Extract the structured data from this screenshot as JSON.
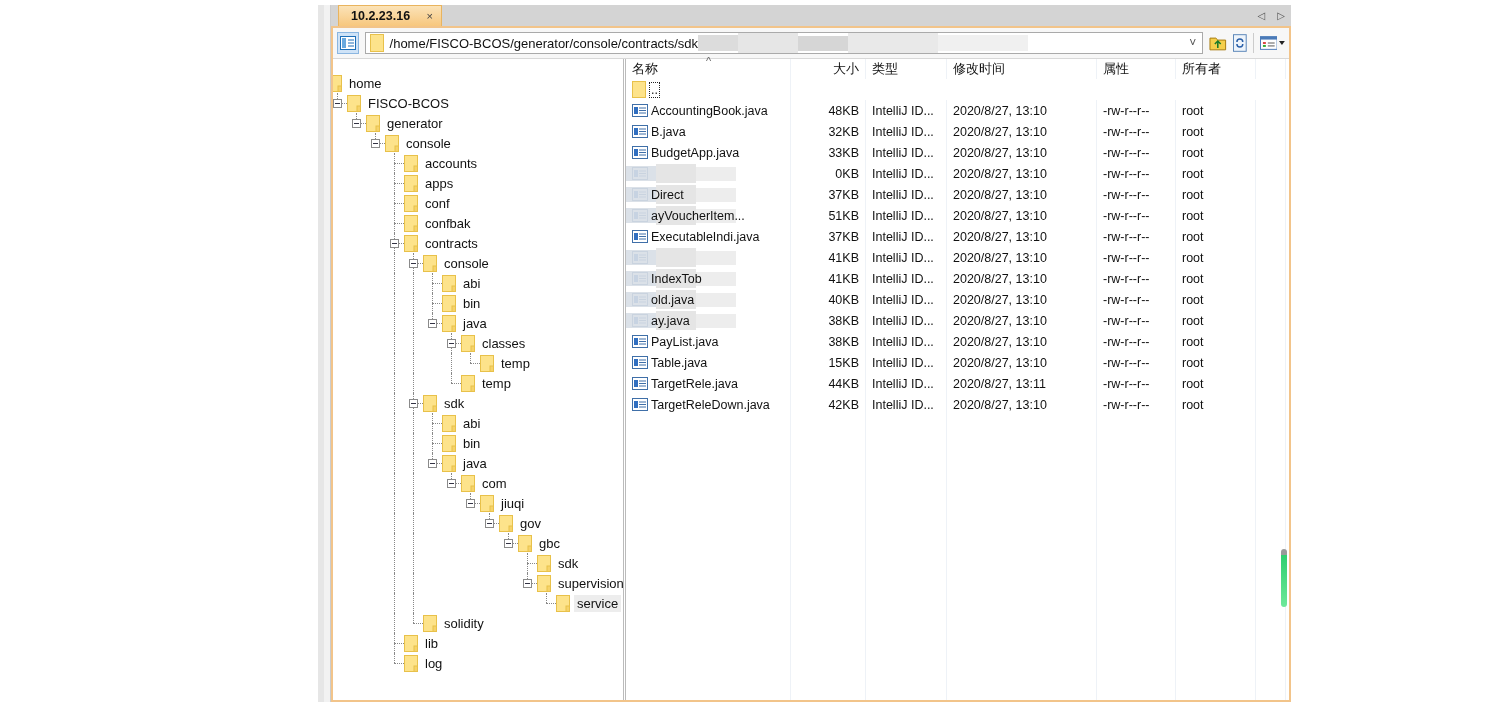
{
  "tabs": [
    {
      "label": "10.2.23.16",
      "selected": true,
      "close": "×"
    }
  ],
  "tab_nav": {
    "prev": "◁",
    "next": "▷"
  },
  "address_bar": {
    "value": "/home/FISCO-BCOS/generator/console/contracts/sdk",
    "redacted": true,
    "dropdown": "˅"
  },
  "tree": [
    {
      "name": "home",
      "selected": false,
      "children": [
        {
          "name": "FISCO-BCOS",
          "selected": false,
          "expanded": true,
          "children": [
            {
              "name": "generator",
              "selected": false,
              "expanded": true,
              "children": [
                {
                  "name": "console",
                  "selected": false,
                  "expanded": true,
                  "children": [
                    {
                      "name": "accounts",
                      "selected": false
                    },
                    {
                      "name": "apps",
                      "selected": false
                    },
                    {
                      "name": "conf",
                      "selected": false
                    },
                    {
                      "name": "confbak",
                      "selected": false
                    },
                    {
                      "name": "contracts",
                      "selected": false,
                      "expanded": true,
                      "children": [
                        {
                          "name": "console",
                          "selected": false,
                          "expanded": true,
                          "children": [
                            {
                              "name": "abi",
                              "selected": false
                            },
                            {
                              "name": "bin",
                              "selected": false
                            },
                            {
                              "name": "java",
                              "selected": false,
                              "expanded": true,
                              "children": [
                                {
                                  "name": "classes",
                                  "selected": false,
                                  "expanded": true,
                                  "children": [
                                    {
                                      "name": "temp",
                                      "selected": false
                                    }
                                  ]
                                },
                                {
                                  "name": "temp",
                                  "selected": false
                                }
                              ]
                            }
                          ]
                        },
                        {
                          "name": "sdk",
                          "selected": false,
                          "expanded": true,
                          "children": [
                            {
                              "name": "abi",
                              "selected": false
                            },
                            {
                              "name": "bin",
                              "selected": false
                            },
                            {
                              "name": "java",
                              "selected": false,
                              "expanded": true,
                              "children": [
                                {
                                  "name": "com",
                                  "selected": false,
                                  "expanded": true,
                                  "children": [
                                    {
                                      "name": "jiuqi",
                                      "selected": false,
                                      "expanded": true,
                                      "children": [
                                        {
                                          "name": "gov",
                                          "selected": false,
                                          "expanded": true,
                                          "children": [
                                            {
                                              "name": "gbc",
                                              "selected": false,
                                              "expanded": true,
                                              "children": [
                                                {
                                                  "name": "sdk",
                                                  "selected": false
                                                },
                                                {
                                                  "name": "supervision",
                                                  "selected": false,
                                                  "expanded": true,
                                                  "children": [
                                                    {
                                                      "name": "service",
                                                      "selected": true
                                                    }
                                                  ]
                                                }
                                              ]
                                            }
                                          ]
                                        }
                                      ]
                                    }
                                  ]
                                }
                              ]
                            }
                          ]
                        },
                        {
                          "name": "solidity",
                          "selected": false
                        }
                      ]
                    },
                    {
                      "name": "lib",
                      "selected": false
                    },
                    {
                      "name": "log",
                      "selected": false
                    }
                  ]
                }
              ]
            }
          ]
        }
      ]
    }
  ],
  "table": {
    "sort_indicator": "^",
    "columns": [
      "名称",
      "大小",
      "类型",
      "修改时间",
      "属性",
      "所有者"
    ],
    "parent_row": "..",
    "rows": [
      {
        "name": "AccountingBook.java",
        "size": "48KB",
        "type": "IntelliJ ID...",
        "modified": "2020/8/27, 13:10",
        "attributes": "-rw-r--r--",
        "owner": "root",
        "redacted": false
      },
      {
        "name": "B.java",
        "size": "32KB",
        "type": "IntelliJ ID...",
        "modified": "2020/8/27, 13:10",
        "attributes": "-rw-r--r--",
        "owner": "root",
        "redacted": false
      },
      {
        "name": "BudgetApp.java",
        "size": "33KB",
        "type": "IntelliJ ID...",
        "modified": "2020/8/27, 13:10",
        "attributes": "-rw-r--r--",
        "owner": "root",
        "redacted": false
      },
      {
        "name": "",
        "size": "0KB",
        "type": "IntelliJ ID...",
        "modified": "2020/8/27, 13:10",
        "attributes": "-rw-r--r--",
        "owner": "root",
        "redacted": true
      },
      {
        "name": "Direct",
        "size": "37KB",
        "type": "IntelliJ ID...",
        "modified": "2020/8/27, 13:10",
        "attributes": "-rw-r--r--",
        "owner": "root",
        "redacted": true
      },
      {
        "name": "ayVoucherItem...",
        "size": "51KB",
        "type": "IntelliJ ID...",
        "modified": "2020/8/27, 13:10",
        "attributes": "-rw-r--r--",
        "owner": "root",
        "redacted": true
      },
      {
        "name": "ExecutableIndi.java",
        "size": "37KB",
        "type": "IntelliJ ID...",
        "modified": "2020/8/27, 13:10",
        "attributes": "-rw-r--r--",
        "owner": "root",
        "redacted": false
      },
      {
        "name": "",
        "size": "41KB",
        "type": "IntelliJ ID...",
        "modified": "2020/8/27, 13:10",
        "attributes": "-rw-r--r--",
        "owner": "root",
        "redacted": true
      },
      {
        "name": "IndexTob",
        "size": "41KB",
        "type": "IntelliJ ID...",
        "modified": "2020/8/27, 13:10",
        "attributes": "-rw-r--r--",
        "owner": "root",
        "redacted": true
      },
      {
        "name": "old.java",
        "size": "40KB",
        "type": "IntelliJ ID...",
        "modified": "2020/8/27, 13:10",
        "attributes": "-rw-r--r--",
        "owner": "root",
        "redacted": true
      },
      {
        "name": "ay.java",
        "size": "38KB",
        "type": "IntelliJ ID...",
        "modified": "2020/8/27, 13:10",
        "attributes": "-rw-r--r--",
        "owner": "root",
        "redacted": true
      },
      {
        "name": "PayList.java",
        "size": "38KB",
        "type": "IntelliJ ID...",
        "modified": "2020/8/27, 13:10",
        "attributes": "-rw-r--r--",
        "owner": "root",
        "redacted": false
      },
      {
        "name": "Table.java",
        "size": "15KB",
        "type": "IntelliJ ID...",
        "modified": "2020/8/27, 13:10",
        "attributes": "-rw-r--r--",
        "owner": "root",
        "redacted": false
      },
      {
        "name": "TargetRele.java",
        "size": "44KB",
        "type": "IntelliJ ID...",
        "modified": "2020/8/27, 13:11",
        "attributes": "-rw-r--r--",
        "owner": "root",
        "redacted": false
      },
      {
        "name": "TargetReleDown.java",
        "size": "42KB",
        "type": "IntelliJ ID...",
        "modified": "2020/8/27, 13:10",
        "attributes": "-rw-r--r--",
        "owner": "root",
        "redacted": false
      }
    ]
  }
}
